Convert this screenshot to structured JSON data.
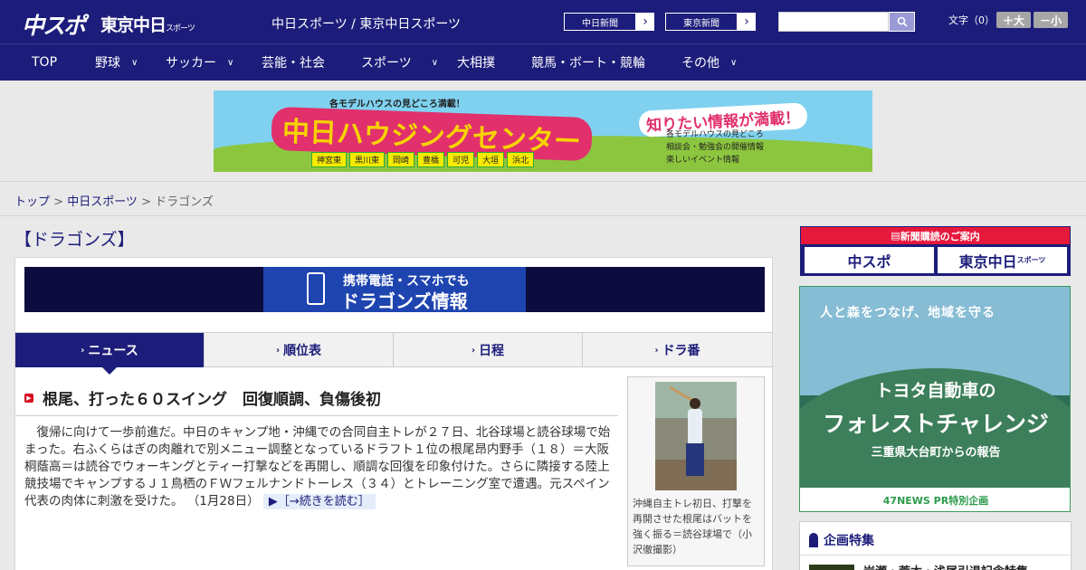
{
  "header": {
    "logo_chuspo": "中スポ",
    "logo_tokyo": "東京中日",
    "logo_tokyo_suffix": "スポーツ",
    "site_title": "中日スポーツ / 東京中日スポーツ",
    "ext_link_1": "中日新聞",
    "ext_link_2": "東京新聞",
    "search_placeholder": "",
    "font_size_label": "文字（0）",
    "font_larger": "＋大",
    "font_smaller": "－小"
  },
  "nav": {
    "items": [
      {
        "label": "TOP"
      },
      {
        "label": "野球"
      },
      {
        "label": "サッカー"
      },
      {
        "label": "芸能・社会"
      },
      {
        "label": "スポーツ"
      },
      {
        "label": "大相撲"
      },
      {
        "label": "競馬・ボート・競輪"
      },
      {
        "label": "その他"
      }
    ]
  },
  "ad_banner": {
    "top_caption": "各モデルハウスの見どころ満載！",
    "main_text": "中日ハウジングセンター",
    "right_caption": "知りたい情報が満載！",
    "bullet_1": "各モデルハウスの見どころ",
    "bullet_2": "相談会・勉強会の開催情報",
    "bullet_3": "楽しいイベント情報",
    "towns": [
      "神宮東",
      "黒川東",
      "岡崎",
      "豊橋",
      "可児",
      "大垣",
      "浜北"
    ]
  },
  "breadcrumb": {
    "home": "トップ",
    "sep": " > ",
    "parent": "中日スポーツ",
    "current": "ドラゴンズ"
  },
  "section_title": "【ドラゴンズ】",
  "mobile_banner": {
    "line1": "携帯電話・スマホでも",
    "line2": "ドラゴンズ情報"
  },
  "tabs": [
    {
      "label": "ニュース"
    },
    {
      "label": "順位表"
    },
    {
      "label": "日程"
    },
    {
      "label": "ドラ番"
    }
  ],
  "article": {
    "headline": "根尾、打った６０スイング　回復順調、負傷後初",
    "body": "復帰に向けて一歩前進だ。中日のキャンプ地・沖縄での合同自主トレが２７日、北谷球場と読谷球場で始まった。右ふくらはぎの肉離れで別メニュー調整となっているドラフト１位の根尾昂内野手（１８）＝大阪桐蔭高＝は読谷でウォーキングとティー打撃などを再開し、順調な回復を印象付けた。さらに隣接する陸上競技場でキャンプするＪ１鳥栖のＦＷフェルナンドトーレス（３４）とトレーニング室で遭遇。元スペイン代表の肉体に刺激を受けた。",
    "date": "（1月28日）",
    "read_more": "［→続きを読む］",
    "photo_caption": "沖縄自主トレ初日、打撃を再開させた根尾はバットを強く振る＝読谷球場で（小沢徹撮影）"
  },
  "sidebar": {
    "subscription_head": "新聞購読のご案内",
    "sub_btn_1": "中スポ",
    "sub_btn_2": "東京中日",
    "sub_btn_2_suffix": "スポーツ",
    "forest_arc": "人と森をつなげ、地域を守る",
    "forest_t1": "トヨタ自動車の",
    "forest_t2": "フォレストチャレンジ",
    "forest_t3": "三重県大台町からの報告",
    "forest_foot": "47NEWS PR特別企画",
    "feature_head": "企画特集",
    "feature_item": "岩瀬・荒木・浅尾引退記念特集"
  }
}
